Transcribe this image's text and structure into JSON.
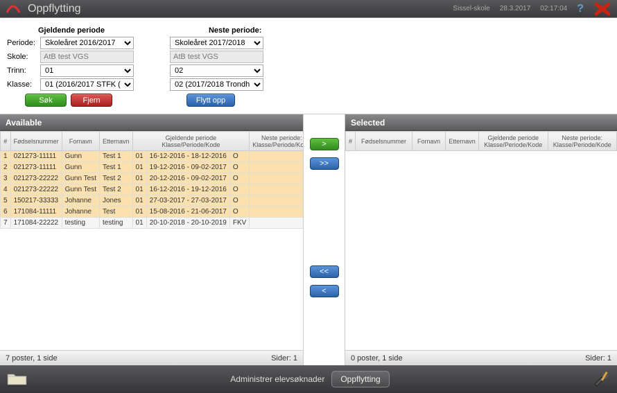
{
  "titlebar": {
    "title": "Oppflytting",
    "school": "Sissel-skole",
    "date": "28.3.2017",
    "time": "02:17:04"
  },
  "filters": {
    "gjeldende_label": "Gjeldende periode",
    "neste_label": "Neste periode:",
    "periode_label": "Periode:",
    "skole_label": "Skole:",
    "trinn_label": "Trinn:",
    "klasse_label": "Klasse:",
    "gjeldende": {
      "periode": "Skoleåret 2016/2017",
      "skole": "AtB test VGS",
      "trinn": "01",
      "klasse": "01 (2016/2017 STFK ("
    },
    "neste": {
      "periode": "Skoleåret 2017/2018",
      "skole": "AtB test VGS",
      "trinn": "02",
      "klasse": "02 (2017/2018 Trondh"
    },
    "sok_label": "Søk",
    "fjern_label": "Fjern",
    "flytt_opp_label": "Flytt opp"
  },
  "available": {
    "title": "Available",
    "headers": {
      "num": "#",
      "fnr": "Fødselsnummer",
      "fornavn": "Fornavn",
      "etternavn": "Etternavn",
      "gjeldende": "Gjeldende periode",
      "gjeldende_sub": "Klasse/Periode/Kode",
      "neste": "Neste periode:",
      "neste_sub": "Klasse/Periode/Kode"
    },
    "rows": [
      {
        "n": "1",
        "fnr": "021273-11111",
        "fornavn": "Gunn",
        "etternavn": "Test 1",
        "cls": "01",
        "periode": "16-12-2016 - 18-12-2016",
        "kode": "O",
        "hl": true
      },
      {
        "n": "2",
        "fnr": "021273-11111",
        "fornavn": "Gunn",
        "etternavn": "Test 1",
        "cls": "01",
        "periode": "19-12-2016 - 09-02-2017",
        "kode": "O",
        "hl": true
      },
      {
        "n": "3",
        "fnr": "021273-22222",
        "fornavn": "Gunn Test",
        "etternavn": "Test 2",
        "cls": "01",
        "periode": "20-12-2016 - 09-02-2017",
        "kode": "O",
        "hl": true
      },
      {
        "n": "4",
        "fnr": "021273-22222",
        "fornavn": "Gunn Test",
        "etternavn": "Test 2",
        "cls": "01",
        "periode": "16-12-2016 - 19-12-2016",
        "kode": "O",
        "hl": true
      },
      {
        "n": "5",
        "fnr": "150217-33333",
        "fornavn": "Johanne",
        "etternavn": "Jones",
        "cls": "01",
        "periode": "27-03-2017 - 27-03-2017",
        "kode": "O",
        "hl": true
      },
      {
        "n": "6",
        "fnr": "171084-11111",
        "fornavn": "Johanne",
        "etternavn": "Test",
        "cls": "01",
        "periode": "15-08-2016 - 21-06-2017",
        "kode": "O",
        "hl": true
      },
      {
        "n": "7",
        "fnr": "171084-22222",
        "fornavn": "testing",
        "etternavn": "testing",
        "cls": "01",
        "periode": "20-10-2018 - 20-10-2019",
        "kode": "FKV",
        "hl": false
      }
    ],
    "pager_left": "7 poster, 1 side",
    "pager_right": "Sider:  1"
  },
  "selected": {
    "title": "Selected",
    "headers": {
      "num": "#",
      "fnr": "Fødselsnummer",
      "fornavn": "Fornavn",
      "etternavn": "Etternavn",
      "gjeldende": "Gjeldende periode",
      "gjeldende_sub": "Klasse/Periode/Kode",
      "neste": "Neste periode:",
      "neste_sub": "Klasse/Periode/Kode"
    },
    "pager_left": "0 poster, 1 side",
    "pager_right": "Sider:  1"
  },
  "transfer": {
    "one_right": ">",
    "all_right": ">>",
    "all_left": "<<",
    "one_left": "<"
  },
  "footer": {
    "admin_label": "Administrer elevsøknader",
    "oppflytting_label": "Oppflytting"
  }
}
